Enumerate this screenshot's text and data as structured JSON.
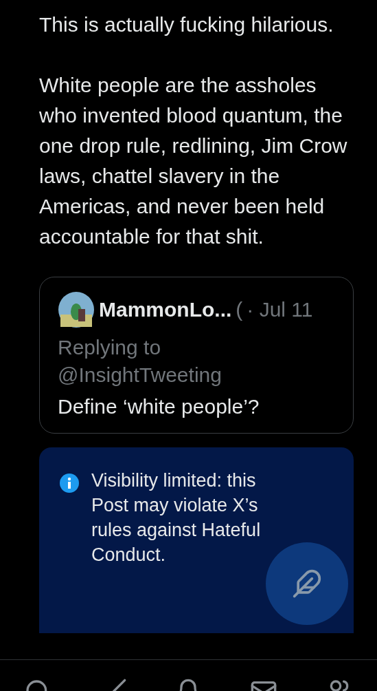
{
  "post": {
    "paragraphs": [
      "This is actually fucking hilarious.",
      "White people are the assholes who invented blood quantum, the one drop rule, redlining, Jim Crow laws, chattel slavery in the Americas, and never been held accountable for that shit."
    ]
  },
  "quoted_post": {
    "display_name": "MammonLo...",
    "handle_fragment": "(",
    "date": "· Jul 11",
    "replying_label": "Replying to",
    "replying_handle": "@InsightTweeting",
    "text": "Define ‘white people’?"
  },
  "notice": {
    "text": "Visibility limited: this Post may violate X’s rules against Hateful Conduct."
  }
}
